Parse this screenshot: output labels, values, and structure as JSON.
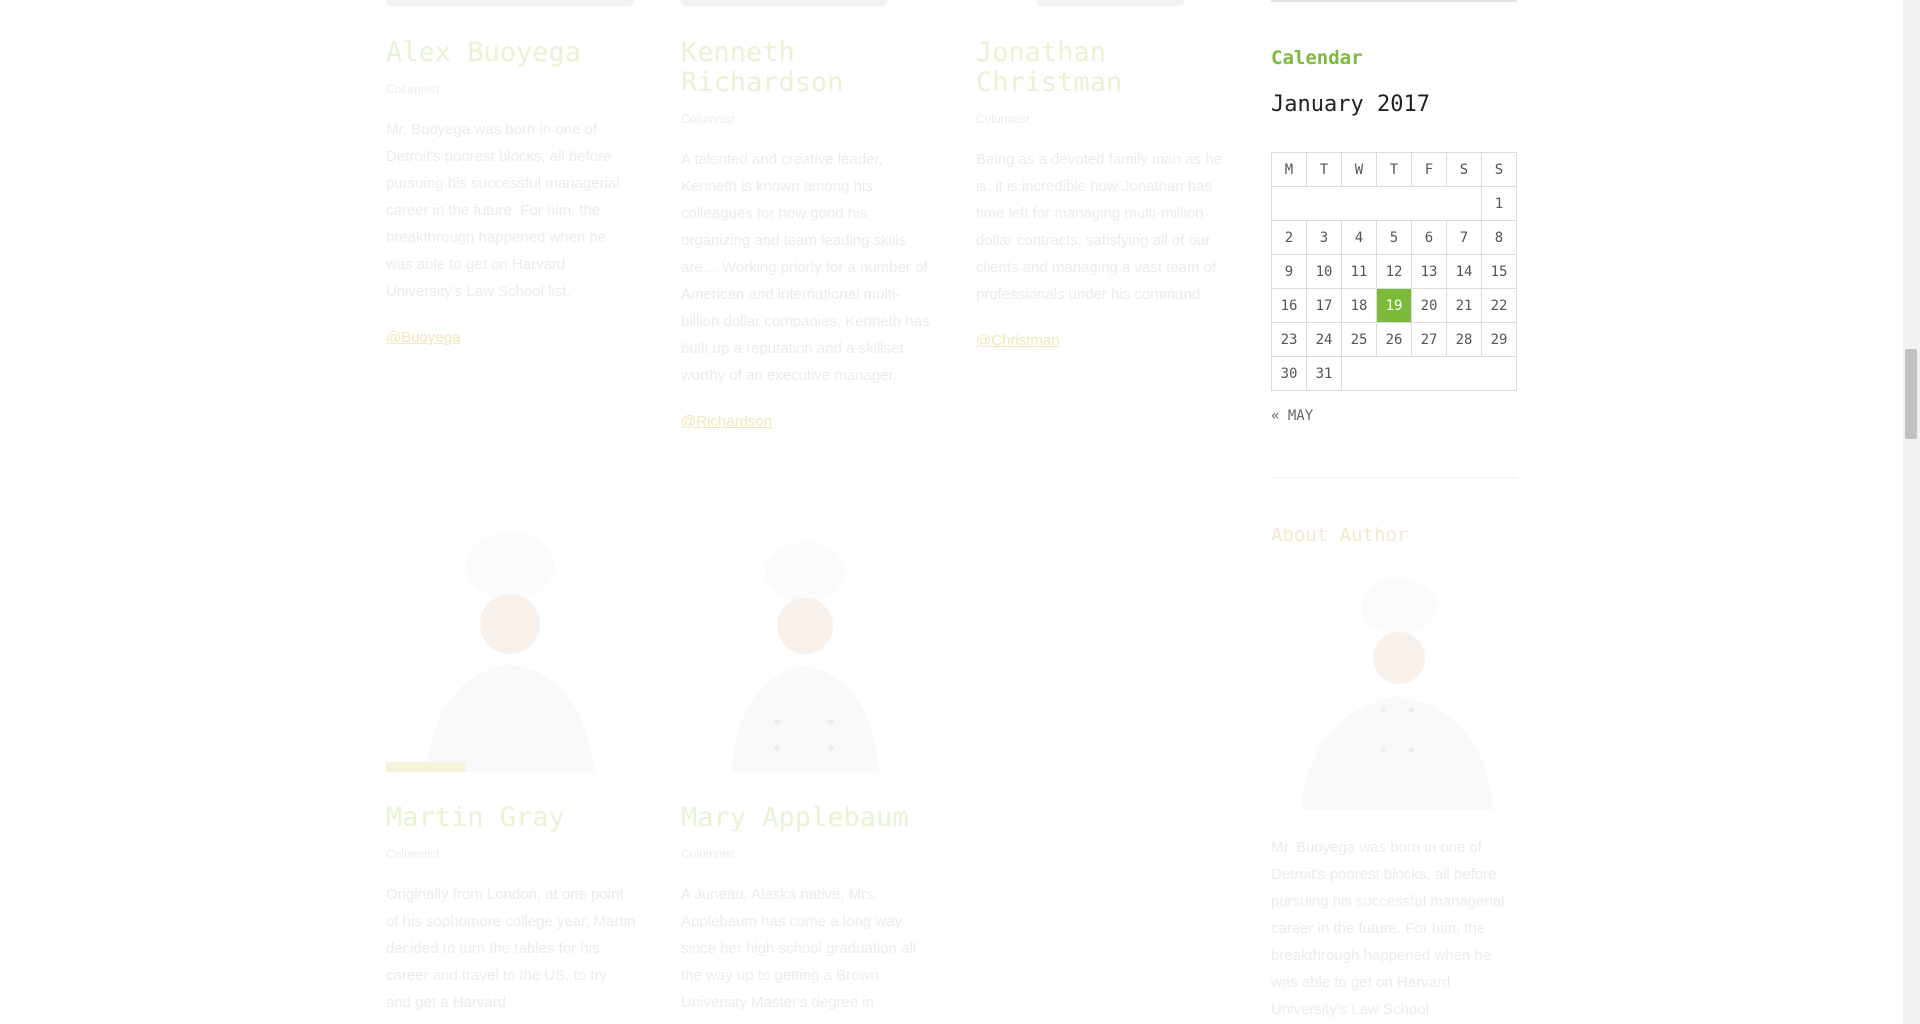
{
  "team": {
    "row1": [
      {
        "name": "Alex Buoyega",
        "role": "Columnist",
        "bio": "Mr. Buoyega was born in one of Detroit's poorest blocks, all before pursuing his successful managerial career in the future. For him, the breakthrough happened when he was able to get on Harvard University's Law School list.",
        "handle": "@Buoyega"
      },
      {
        "name": "Kenneth Richardson",
        "role": "Columnist",
        "bio": "A talented and creative leader, Kenneth is known among his colleagues for how good his organizing and team leading skills are… Working priorly for a number of American and international multi-billion dollar companies, Kenneth has built up a reputation and a skillset worthy of an executive manager.",
        "handle": "@Richardson"
      },
      {
        "name": "Jonathan Christman",
        "role": "Columnist",
        "bio": "Being as a devoted family man as he is, it is incredible how Jonathan has time left for managing multi-million dollar contracts, satisfying all of our clients and managing a vast team of professionals under his command.",
        "handle": "@Christman"
      }
    ],
    "row2": [
      {
        "name": "Martin Gray",
        "role": "Columnist",
        "bio": "Originally from London, at one point of his sophomore college year, Martin decided to turn the tables for his career and travel to the US, to try and get a Harvard"
      },
      {
        "name": "Mary Applebaum",
        "role": "Columnist",
        "bio": "A Juneau, Alaska native, Mrs. Applebaum has come a long way since her high school graduation all the way up to getting a Brown University Master's degree in"
      }
    ]
  },
  "sidebar": {
    "calendar": {
      "title": "Calendar",
      "caption": "January 2017",
      "weekdays": [
        "M",
        "T",
        "W",
        "T",
        "F",
        "S",
        "S"
      ],
      "weeks": [
        [
          "",
          "",
          "",
          "",
          "",
          "",
          "1"
        ],
        [
          "2",
          "3",
          "4",
          "5",
          "6",
          "7",
          "8"
        ],
        [
          "9",
          "10",
          "11",
          "12",
          "13",
          "14",
          "15"
        ],
        [
          "16",
          "17",
          "18",
          "19",
          "20",
          "21",
          "22"
        ],
        [
          "23",
          "24",
          "25",
          "26",
          "27",
          "28",
          "29"
        ],
        [
          "30",
          "31",
          "",
          "",
          "",
          "",
          ""
        ]
      ],
      "today": "19",
      "prev_link": "« MAY"
    },
    "about": {
      "title": "About Author",
      "bio": "Mr. Buoyega was born in one of Detroit's poorest blocks, all before pursuing his successful managerial career in the future. For him, the breakthrough happened when he was able to get on Harvard University's Law School"
    }
  },
  "colors": {
    "accent": "#7cbb3a",
    "faded_title": "#e8f3d6",
    "faded_text": "#ececec"
  },
  "icons": [
    "chef-photo",
    "chef-photo",
    "chef-photo"
  ]
}
